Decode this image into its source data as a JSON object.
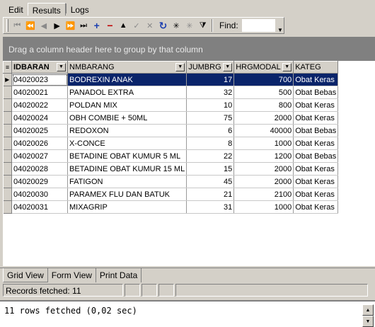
{
  "tabs": [
    {
      "label": "Edit",
      "active": false
    },
    {
      "label": "Results",
      "active": true
    },
    {
      "label": "Logs",
      "active": false
    }
  ],
  "toolbar": {
    "icons": [
      "first-record",
      "prior-page",
      "prior-record",
      "next-record",
      "next-page",
      "last-record",
      "insert-record",
      "delete-record",
      "edit-record",
      "post-edit",
      "cancel-edit",
      "refresh",
      "filter-asterisk",
      "clear-filter",
      "filter"
    ],
    "find_label": "Find:",
    "find_value": ""
  },
  "group_panel": {
    "text": "Drag a column header here to group by that column"
  },
  "grid": {
    "columns": [
      "IDBARAN",
      "NMBARANG",
      "JUMBRG",
      "HRGMODAL",
      "KATEG"
    ],
    "rows": [
      [
        "04020023",
        "BODREXIN ANAK",
        "17",
        "700",
        "Obat Keras"
      ],
      [
        "04020021",
        "PANADOL EXTRA",
        "32",
        "500",
        "Obat Bebas"
      ],
      [
        "04020022",
        "POLDAN MIX",
        "10",
        "800",
        "Obat Keras"
      ],
      [
        "04020024",
        "OBH COMBIE + 50ML",
        "75",
        "2000",
        "Obat Keras"
      ],
      [
        "04020025",
        "REDOXON",
        "6",
        "40000",
        "Obat Bebas"
      ],
      [
        "04020026",
        "X-CONCE",
        "8",
        "1000",
        "Obat Keras"
      ],
      [
        "04020027",
        "BETADINE OBAT KUMUR 5 ML",
        "22",
        "1200",
        "Obat Bebas"
      ],
      [
        "04020028",
        "BETADINE OBAT KUMUR 15 ML",
        "15",
        "2000",
        "Obat Keras"
      ],
      [
        "04020029",
        "FATIGON",
        "45",
        "2000",
        "Obat Keras"
      ],
      [
        "04020030",
        "PARAMEX FLU DAN BATUK",
        "21",
        "2100",
        "Obat Keras"
      ],
      [
        "04020031",
        "MIXAGRIP",
        "31",
        "1000",
        "Obat Keras"
      ]
    ],
    "selected_row": 0
  },
  "bottom_tabs": [
    {
      "label": "Grid View",
      "active": true
    },
    {
      "label": "Form View",
      "active": false
    },
    {
      "label": "Print Data",
      "active": false
    }
  ],
  "status": {
    "records": "Records fetched: 11"
  },
  "message": {
    "text": "11 rows fetched (0,02 sec)"
  },
  "colors": {
    "selection": "#0a246a",
    "panel": "#d4d0c8",
    "group_panel": "#808080"
  }
}
